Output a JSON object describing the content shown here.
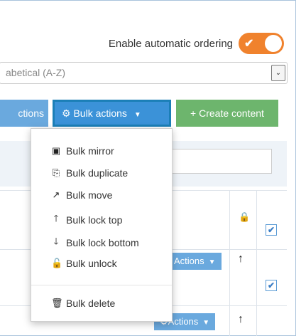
{
  "toggle": {
    "label": "Enable automatic ordering",
    "checkmark": "✔",
    "on": true,
    "color": "#f0822d"
  },
  "sort": {
    "value": "abetical (A-Z)",
    "arrow": "⌄"
  },
  "buttons": {
    "actions_label": "ctions",
    "bulk_icon": "⚙",
    "bulk_label": "Bulk actions",
    "create_icon": "+",
    "create_label": "Create content",
    "caret": "▼"
  },
  "table": {
    "lock_icon": "🔒",
    "header_checked": "✔",
    "rows": [
      {
        "actions_label": "Actions",
        "checked": "✔",
        "arrow": "↑"
      },
      {
        "actions_label": "Actions",
        "arrow": "↑"
      }
    ]
  },
  "menu": {
    "items": [
      {
        "icon": "▣",
        "label": "Bulk mirror"
      },
      {
        "icon": "⎘",
        "label": "Bulk duplicate"
      },
      {
        "icon": "↗",
        "label": "Bulk move"
      },
      {
        "icon": "🡑",
        "label": "Bulk lock top"
      },
      {
        "icon": "🡓",
        "label": "Bulk lock bottom"
      },
      {
        "icon": "🔓",
        "label": "Bulk unlock"
      }
    ],
    "delete": {
      "icon": "🗑",
      "label": "Bulk delete"
    }
  },
  "colors": {
    "primary": "#3b92d8",
    "success": "#6db56d",
    "accent": "#f0822d"
  }
}
